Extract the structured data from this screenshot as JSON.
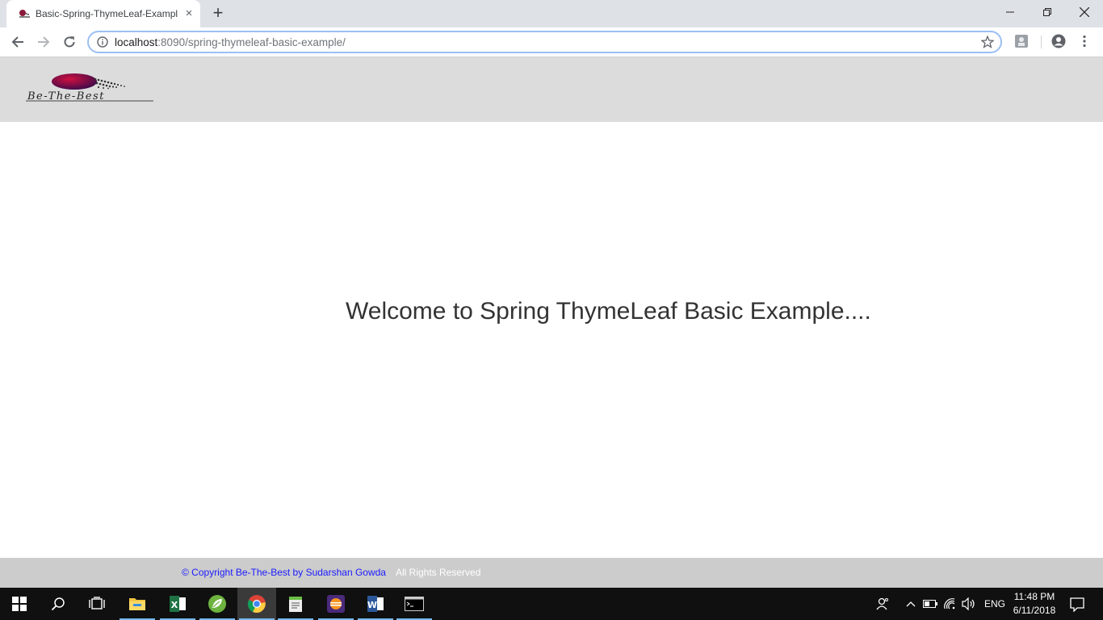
{
  "browser": {
    "tab": {
      "title": "Basic-Spring-ThymeLeaf-Example",
      "close": "×"
    },
    "new_tab": "+",
    "url": {
      "host": "localhost",
      "rest": ":8090/spring-thymeleaf-basic-example/"
    }
  },
  "page": {
    "logo_text": "Be-The-Best",
    "welcome": "Welcome to Spring ThymeLeaf Basic Example....",
    "footer": {
      "copyright": "© Copyright Be-The-Best by Sudarshan Gowda",
      "rights": "All Rights Reserved"
    }
  },
  "taskbar": {
    "apps": [
      "windows-start",
      "search",
      "task-view",
      "file-explorer",
      "excel",
      "spring-tool-suite",
      "chrome",
      "notepad-plus-plus",
      "eclipse-ide",
      "word",
      "command-prompt"
    ],
    "language": "ENG",
    "time": "11:48 PM",
    "date": "6/11/2018"
  },
  "colors": {
    "header_bg": "#dcdcdc",
    "footer_bg": "#cccccc",
    "copyright_link": "#1a1aff",
    "taskbar": "#101010"
  }
}
